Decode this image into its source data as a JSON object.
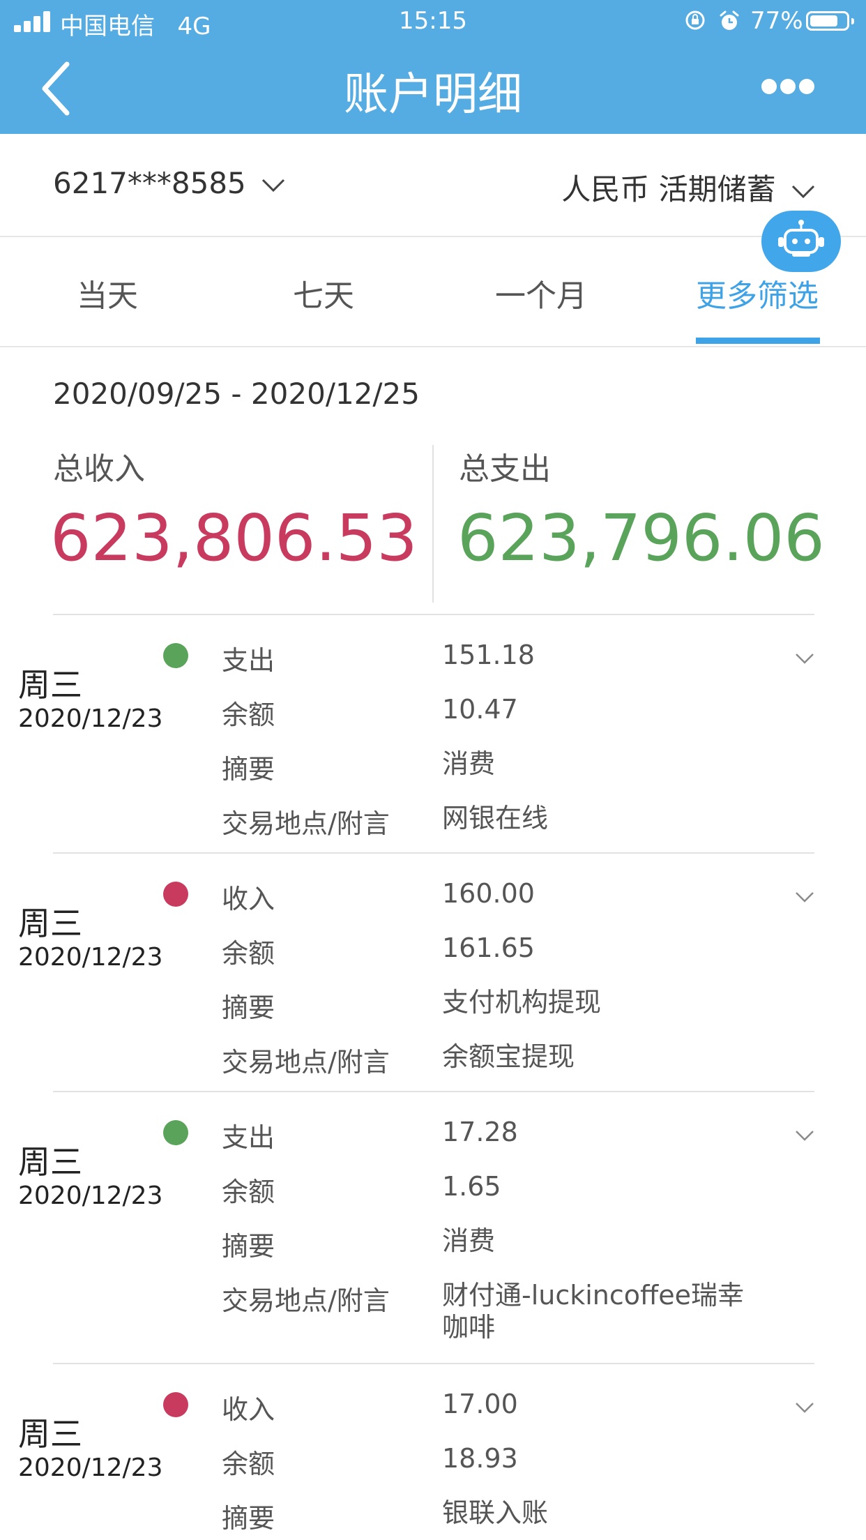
{
  "status_bar": {
    "carrier": "中国电信",
    "network": "4G",
    "time": "15:15",
    "battery_pct": "77%",
    "battery_level": 0.77
  },
  "header": {
    "title": "账户明细",
    "back_icon": "chevron-left-icon",
    "more_icon": "more-dots-icon"
  },
  "account": {
    "number": "6217***8585",
    "currency_type": "人民币 活期储蓄"
  },
  "tabs": [
    {
      "label": "当天",
      "active": false
    },
    {
      "label": "七天",
      "active": false
    },
    {
      "label": "一个月",
      "active": false
    },
    {
      "label": "更多筛选",
      "active": true
    }
  ],
  "summary": {
    "date_range": "2020/09/25 - 2020/12/25",
    "income_label": "总收入",
    "income_value": "623,806.53",
    "expense_label": "总支出",
    "expense_value": "623,796.06"
  },
  "colors": {
    "header_blue": "#55ace3",
    "accent_blue": "#3ea3e6",
    "income_red": "#c83a5e",
    "expense_green": "#5aa35a"
  },
  "transactions": [
    {
      "weekday": "周三",
      "date": "2020/12/23",
      "kind": "expense",
      "type_label": "支出",
      "amount": "151.18",
      "balance_label": "余额",
      "balance": "10.47",
      "summary_label": "摘要",
      "summary": "消费",
      "place_label": "交易地点/附言",
      "place_line1": "网银在线",
      "place_line2": ""
    },
    {
      "weekday": "周三",
      "date": "2020/12/23",
      "kind": "income",
      "type_label": "收入",
      "amount": "160.00",
      "balance_label": "余额",
      "balance": "161.65",
      "summary_label": "摘要",
      "summary": "支付机构提现",
      "place_label": "交易地点/附言",
      "place_line1": "余额宝提现",
      "place_line2": ""
    },
    {
      "weekday": "周三",
      "date": "2020/12/23",
      "kind": "expense",
      "type_label": "支出",
      "amount": "17.28",
      "balance_label": "余额",
      "balance": "1.65",
      "summary_label": "摘要",
      "summary": "消费",
      "place_label": "交易地点/附言",
      "place_line1": "财付通-luckincoffee瑞幸",
      "place_line2": "咖啡"
    },
    {
      "weekday": "周三",
      "date": "2020/12/23",
      "kind": "income",
      "type_label": "收入",
      "amount": "17.00",
      "balance_label": "余额",
      "balance": "18.93",
      "summary_label": "摘要",
      "summary": "银联入账",
      "place_label": "",
      "place_line1": "",
      "place_line2": ""
    }
  ]
}
